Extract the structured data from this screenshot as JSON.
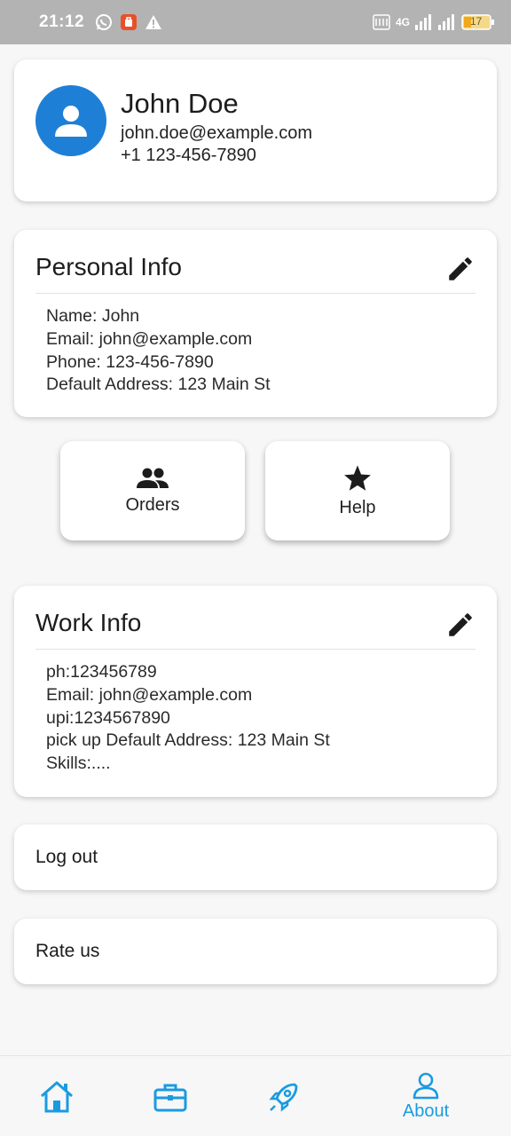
{
  "status_bar": {
    "time": "21:12",
    "network_label": "4G",
    "battery": "17",
    "icons": [
      "whatsapp-icon",
      "app-notification-icon",
      "warning-icon",
      "volte-icon",
      "signal-icon",
      "battery-icon"
    ]
  },
  "profile": {
    "name": "John Doe",
    "email": "john.doe@example.com",
    "phone": "+1 123-456-7890",
    "avatar_icon": "person-icon",
    "avatar_color": "#1e7fd6"
  },
  "personal_info": {
    "title": "Personal Info",
    "lines": [
      "Name: John",
      "Email: john@example.com",
      "Phone: 123-456-7890",
      "Default Address: 123 Main St"
    ]
  },
  "actions": {
    "orders_label": "Orders",
    "help_label": "Help"
  },
  "work_info": {
    "title": "Work Info",
    "lines": [
      "ph:123456789",
      "Email: john@example.com",
      "upi:1234567890",
      "pick up Default Address: 123 Main St",
      "Skills:...."
    ]
  },
  "menu": {
    "logout_label": "Log out",
    "rate_label": "Rate us"
  },
  "bottom_nav": {
    "about_label": "About",
    "active": "About",
    "accent_color": "#1a9be0"
  }
}
